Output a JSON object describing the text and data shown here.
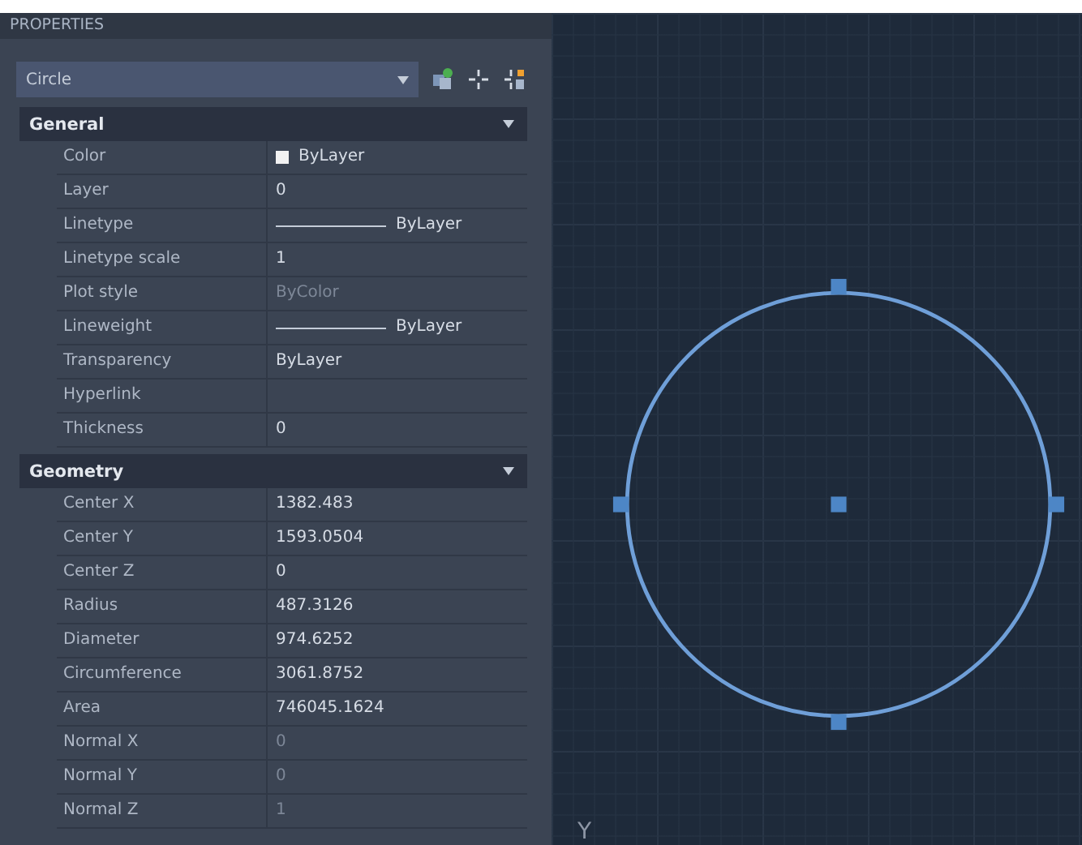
{
  "panel": {
    "title": "PROPERTIES",
    "selector": {
      "value": "Circle"
    }
  },
  "sections": [
    {
      "title": "General",
      "expanded": true,
      "rows": [
        {
          "label": "Color",
          "value": "ByLayer",
          "kind": "color",
          "disabled": false
        },
        {
          "label": "Layer",
          "value": "0",
          "kind": "text",
          "disabled": false
        },
        {
          "label": "Linetype",
          "value": "ByLayer",
          "kind": "line",
          "disabled": false
        },
        {
          "label": "Linetype scale",
          "value": "1",
          "kind": "text",
          "disabled": false
        },
        {
          "label": "Plot style",
          "value": "ByColor",
          "kind": "text",
          "disabled": true
        },
        {
          "label": "Lineweight",
          "value": "ByLayer",
          "kind": "line",
          "disabled": false
        },
        {
          "label": "Transparency",
          "value": "ByLayer",
          "kind": "text",
          "disabled": false
        },
        {
          "label": "Hyperlink",
          "kind": "text"
        },
        {
          "label": "Thickness",
          "value": "0",
          "kind": "text",
          "disabled": false
        }
      ]
    },
    {
      "title": "Geometry",
      "expanded": true,
      "rows": [
        {
          "label": "Center X",
          "value": "1382.483",
          "kind": "text",
          "disabled": false
        },
        {
          "label": "Center Y",
          "value": "1593.0504",
          "kind": "text",
          "disabled": false
        },
        {
          "label": "Center Z",
          "value": "0",
          "kind": "text",
          "disabled": false
        },
        {
          "label": "Radius",
          "value": "487.3126",
          "kind": "text",
          "disabled": false
        },
        {
          "label": "Diameter",
          "value": "974.6252",
          "kind": "text",
          "disabled": false
        },
        {
          "label": "Circumference",
          "value": "3061.8752",
          "kind": "text",
          "disabled": false
        },
        {
          "label": "Area",
          "value": "746045.1624",
          "kind": "text",
          "disabled": false
        },
        {
          "label": "Normal X",
          "value": "0",
          "kind": "text",
          "disabled": true
        },
        {
          "label": "Normal Y",
          "value": "0",
          "kind": "text",
          "disabled": true
        },
        {
          "label": "Normal Z",
          "value": "1",
          "kind": "text",
          "disabled": true
        }
      ]
    }
  ],
  "canvas": {
    "axis_label": "Y"
  }
}
